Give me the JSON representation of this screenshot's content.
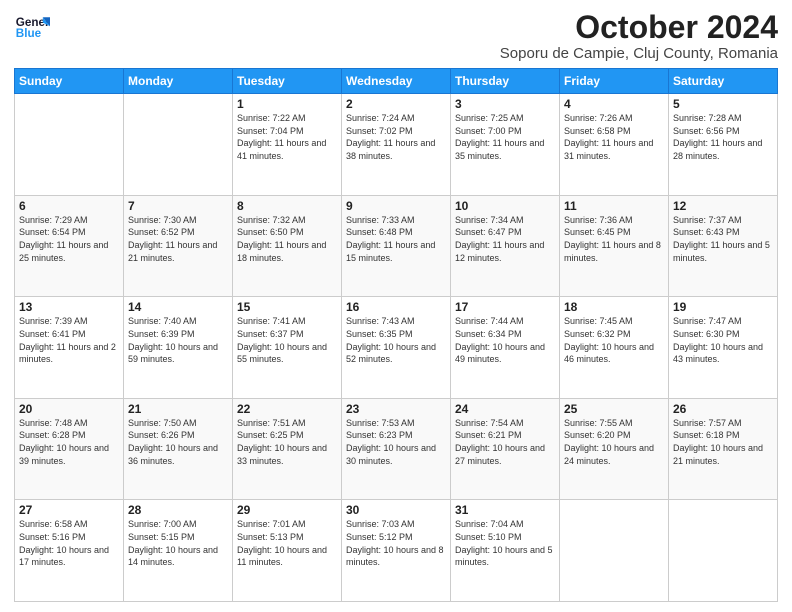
{
  "logo": {
    "line1": "General",
    "line2": "Blue"
  },
  "title": "October 2024",
  "subtitle": "Soporu de Campie, Cluj County, Romania",
  "weekdays": [
    "Sunday",
    "Monday",
    "Tuesday",
    "Wednesday",
    "Thursday",
    "Friday",
    "Saturday"
  ],
  "weeks": [
    [
      {
        "day": "",
        "info": ""
      },
      {
        "day": "",
        "info": ""
      },
      {
        "day": "1",
        "info": "Sunrise: 7:22 AM\nSunset: 7:04 PM\nDaylight: 11 hours and 41 minutes."
      },
      {
        "day": "2",
        "info": "Sunrise: 7:24 AM\nSunset: 7:02 PM\nDaylight: 11 hours and 38 minutes."
      },
      {
        "day": "3",
        "info": "Sunrise: 7:25 AM\nSunset: 7:00 PM\nDaylight: 11 hours and 35 minutes."
      },
      {
        "day": "4",
        "info": "Sunrise: 7:26 AM\nSunset: 6:58 PM\nDaylight: 11 hours and 31 minutes."
      },
      {
        "day": "5",
        "info": "Sunrise: 7:28 AM\nSunset: 6:56 PM\nDaylight: 11 hours and 28 minutes."
      }
    ],
    [
      {
        "day": "6",
        "info": "Sunrise: 7:29 AM\nSunset: 6:54 PM\nDaylight: 11 hours and 25 minutes."
      },
      {
        "day": "7",
        "info": "Sunrise: 7:30 AM\nSunset: 6:52 PM\nDaylight: 11 hours and 21 minutes."
      },
      {
        "day": "8",
        "info": "Sunrise: 7:32 AM\nSunset: 6:50 PM\nDaylight: 11 hours and 18 minutes."
      },
      {
        "day": "9",
        "info": "Sunrise: 7:33 AM\nSunset: 6:48 PM\nDaylight: 11 hours and 15 minutes."
      },
      {
        "day": "10",
        "info": "Sunrise: 7:34 AM\nSunset: 6:47 PM\nDaylight: 11 hours and 12 minutes."
      },
      {
        "day": "11",
        "info": "Sunrise: 7:36 AM\nSunset: 6:45 PM\nDaylight: 11 hours and 8 minutes."
      },
      {
        "day": "12",
        "info": "Sunrise: 7:37 AM\nSunset: 6:43 PM\nDaylight: 11 hours and 5 minutes."
      }
    ],
    [
      {
        "day": "13",
        "info": "Sunrise: 7:39 AM\nSunset: 6:41 PM\nDaylight: 11 hours and 2 minutes."
      },
      {
        "day": "14",
        "info": "Sunrise: 7:40 AM\nSunset: 6:39 PM\nDaylight: 10 hours and 59 minutes."
      },
      {
        "day": "15",
        "info": "Sunrise: 7:41 AM\nSunset: 6:37 PM\nDaylight: 10 hours and 55 minutes."
      },
      {
        "day": "16",
        "info": "Sunrise: 7:43 AM\nSunset: 6:35 PM\nDaylight: 10 hours and 52 minutes."
      },
      {
        "day": "17",
        "info": "Sunrise: 7:44 AM\nSunset: 6:34 PM\nDaylight: 10 hours and 49 minutes."
      },
      {
        "day": "18",
        "info": "Sunrise: 7:45 AM\nSunset: 6:32 PM\nDaylight: 10 hours and 46 minutes."
      },
      {
        "day": "19",
        "info": "Sunrise: 7:47 AM\nSunset: 6:30 PM\nDaylight: 10 hours and 43 minutes."
      }
    ],
    [
      {
        "day": "20",
        "info": "Sunrise: 7:48 AM\nSunset: 6:28 PM\nDaylight: 10 hours and 39 minutes."
      },
      {
        "day": "21",
        "info": "Sunrise: 7:50 AM\nSunset: 6:26 PM\nDaylight: 10 hours and 36 minutes."
      },
      {
        "day": "22",
        "info": "Sunrise: 7:51 AM\nSunset: 6:25 PM\nDaylight: 10 hours and 33 minutes."
      },
      {
        "day": "23",
        "info": "Sunrise: 7:53 AM\nSunset: 6:23 PM\nDaylight: 10 hours and 30 minutes."
      },
      {
        "day": "24",
        "info": "Sunrise: 7:54 AM\nSunset: 6:21 PM\nDaylight: 10 hours and 27 minutes."
      },
      {
        "day": "25",
        "info": "Sunrise: 7:55 AM\nSunset: 6:20 PM\nDaylight: 10 hours and 24 minutes."
      },
      {
        "day": "26",
        "info": "Sunrise: 7:57 AM\nSunset: 6:18 PM\nDaylight: 10 hours and 21 minutes."
      }
    ],
    [
      {
        "day": "27",
        "info": "Sunrise: 6:58 AM\nSunset: 5:16 PM\nDaylight: 10 hours and 17 minutes."
      },
      {
        "day": "28",
        "info": "Sunrise: 7:00 AM\nSunset: 5:15 PM\nDaylight: 10 hours and 14 minutes."
      },
      {
        "day": "29",
        "info": "Sunrise: 7:01 AM\nSunset: 5:13 PM\nDaylight: 10 hours and 11 minutes."
      },
      {
        "day": "30",
        "info": "Sunrise: 7:03 AM\nSunset: 5:12 PM\nDaylight: 10 hours and 8 minutes."
      },
      {
        "day": "31",
        "info": "Sunrise: 7:04 AM\nSunset: 5:10 PM\nDaylight: 10 hours and 5 minutes."
      },
      {
        "day": "",
        "info": ""
      },
      {
        "day": "",
        "info": ""
      }
    ]
  ]
}
